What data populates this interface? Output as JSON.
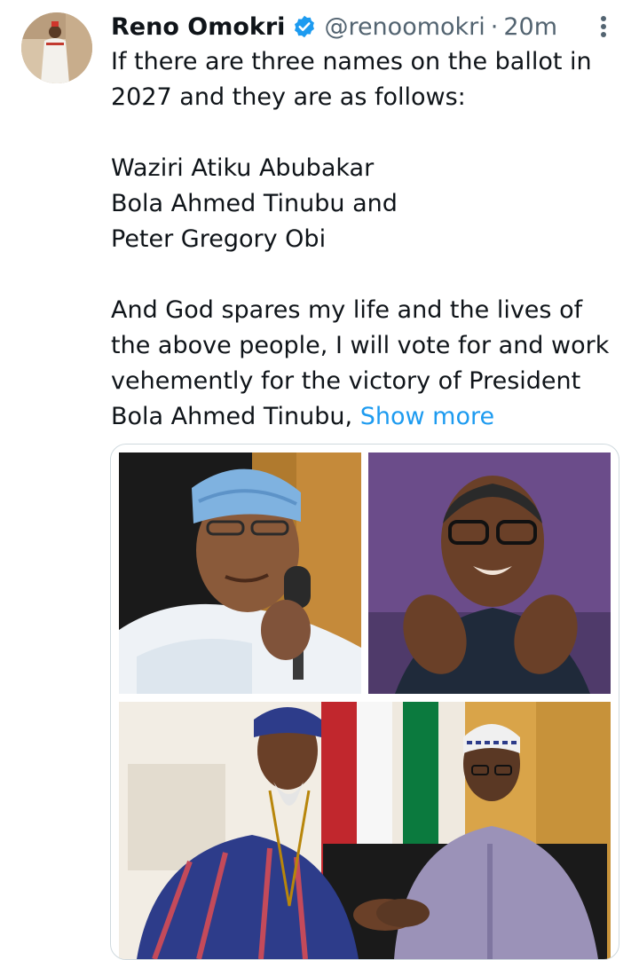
{
  "tweet": {
    "author_name": "Reno Omokri",
    "handle": "@renoomokri",
    "separator": "·",
    "time": "20m",
    "lines": [
      "If there are three names on the ballot in",
      "2027 and they are as follows:",
      "",
      "Waziri Atiku Abubakar",
      "Bola Ahmed Tinubu and",
      "Peter Gregory Obi",
      "",
      "And God spares my life and the lives of",
      "the above people, I will vote for and work",
      "vehemently for the victory of President",
      "Bola Ahmed Tinubu,"
    ],
    "show_more": "Show more"
  },
  "icons": {
    "verified": "verified-badge-icon",
    "more": "more-vertical-icon"
  },
  "colors": {
    "link": "#1d9bf0",
    "secondary_text": "#536471",
    "verified": "#1d9bf0",
    "border": "#cfd9de"
  }
}
